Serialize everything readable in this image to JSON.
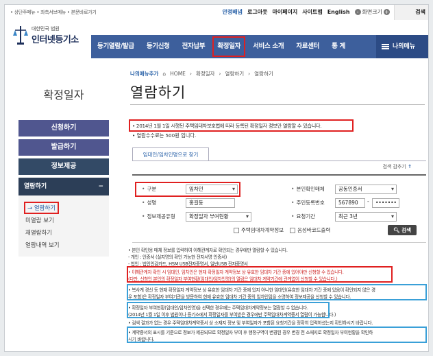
{
  "utility": {
    "skip_links": "• 상단주메뉴 • 좌측서브메뉴 • 본문바로가기",
    "links": [
      "안정배념",
      "로그아웃",
      "마이페이지",
      "사이트맵",
      "English"
    ],
    "zoom_label": "화면크기",
    "zoom_minus": "-",
    "zoom_plus": "+",
    "search_label": "검색"
  },
  "logo": {
    "line1": "대한민국 법원",
    "line2": "인터넷등기소"
  },
  "gnb": {
    "items": [
      "등기열람/발급",
      "등기신청",
      "전자납부",
      "확정일자",
      "서비스 소개",
      "자료센터",
      "통 계"
    ],
    "mymenu": "나의메뉴"
  },
  "lnb": {
    "title": "확정일자",
    "buttons": [
      "신청하기",
      "발급하기",
      "정보제공"
    ],
    "group_title": "열람하기",
    "group_toggle": "−",
    "group_items": [
      "→ 열람하기",
      "미열람 보기",
      "재열람하기",
      "열람내역 보기"
    ]
  },
  "breadcrumb": {
    "favorite": "나의메뉴추가",
    "path": [
      "HOME",
      "확정일자",
      "열람하기",
      "열람하기"
    ]
  },
  "page_title": "열람하기",
  "notice": "• 2014년 1월 1일 시행된 주택임대차보호법에 따라 등록된 확정일자 정보만 열람할 수 있습니다.",
  "fee": "• 열람수수료는 500원 입니다.",
  "tab_label": "임대인/임차인명으로 찾기",
  "toggle": {
    "label": "검색 감추기",
    "arrow": "↑"
  },
  "form": {
    "class_label": "구분",
    "class_value": "임차인",
    "name_label": "성명",
    "name_value": "홍길동",
    "info_label": "정보제공유형",
    "info_value": "확정일자 부여현황",
    "idtype_label": "본인확인매체",
    "idtype_value": "공동인증서",
    "rrn_label": "주민등록번호",
    "rrn_front": "567890",
    "rrn_dash": "-",
    "rrn_back": "•••••••",
    "period_label": "요청기간",
    "period_value": "최근 3년",
    "check1": "주택임대차계약정보",
    "check2": "음성바코드출력",
    "search_button": "검색"
  },
  "notes": [
    "• 본인 확인용 매체 정보를 입력하여 이해관계자로 확인되는 경우에만 열람할 수 있습니다.",
    "  - 개인 : 인증서 (실지명의 확인 가능한 전자서명 인증서)",
    "  - 법인 : 법인인감카드, HSM USB전자증명서, 일반USB 전자증명서",
    "• 이해관계자 확인 시 임대인, 임차인은 현재 확정일자 계약정보 상 유효한 임대차 기간 중에 있어야만 신청할 수 있습니다.",
    "  (다만, 신청인 본인의 확정일자 부여현황(임대인/임차인명)의 열람은 임대차 계약기간에 관계없이 신청할 수 있습니다.)",
    "• 복사계 경신 등 현재 확정일자 계약정보 상 유효한 임대차 기간 중에 있지 아니한 임대인(유효한 임대차 기간 중에 있음이 확인되지 않은 경",
    "  우 포함)은 확정일자 부여기관을 방문하여 현재 유효한 임대차 기간 중의 임차인임을 소명하여 정보제공을 신청할 수 있습니다.",
    "• 확정일자 부여현황(임대인/임차인명)을 선택한 경우에는 주택임대차계약정보는 열람할 수 없습니다.",
    "  (2014년 1월 1일 이후 법원이나 등기소에서 확정일자를 부여받은 경우에만 주택임대차계약증서 열람이 가능합니다.)",
    "• 검색 결과가 없는 경우 주택임대차계약증서 상 소재지 정보 및 부여일자가 포함된 요청기간을 정확히 입력하셨는지 확인하시기 바랍니다.",
    "• 계약증서의 표시를 기준으로 정보가 제공되므로 확정일자 부여 후 행정구역이 변경된 경우 변경 전 소재지로 확정일자 부여현황을 확인하",
    "  시기 바랍니다."
  ]
}
